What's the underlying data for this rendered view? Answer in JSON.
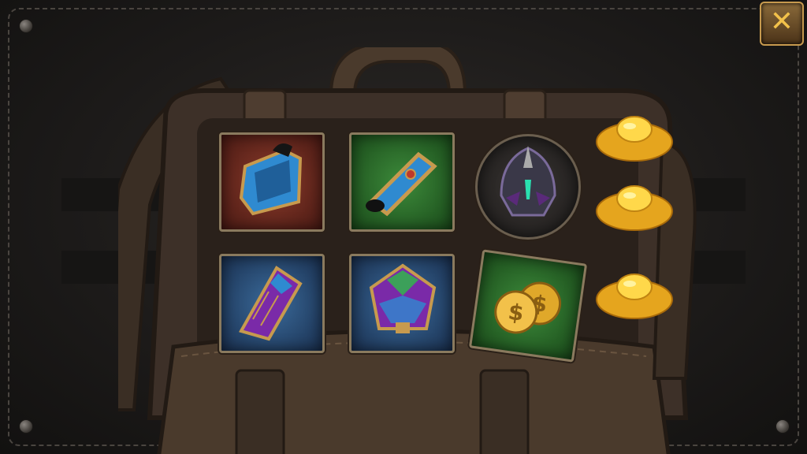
{
  "screen": {
    "name": "inventory-bag-screen",
    "close_glyph": "✕"
  },
  "inventory": {
    "slots": [
      {
        "item": "blue-gold-bracer-armor",
        "background": "red"
      },
      {
        "item": "blue-gauntlet",
        "background": "green"
      },
      {
        "item": "dark-knight-helmet",
        "background": "round-dark"
      },
      {
        "item": "purple-shoulder-armor",
        "background": "blue"
      },
      {
        "item": "purple-chest-armor",
        "background": "blue"
      },
      {
        "item": "gold-coins",
        "background": "green"
      }
    ]
  },
  "rewards": {
    "items": [
      "gold-ingot",
      "gold-ingot",
      "gold-ingot"
    ]
  },
  "colors": {
    "panel": "#1d1b1a",
    "leather": "#4a3a2c",
    "frame": "#8a7a5e",
    "gold": "#f2c14a",
    "armor_blue": "#2f8ad0",
    "armor_purple": "#7a2aa8"
  }
}
